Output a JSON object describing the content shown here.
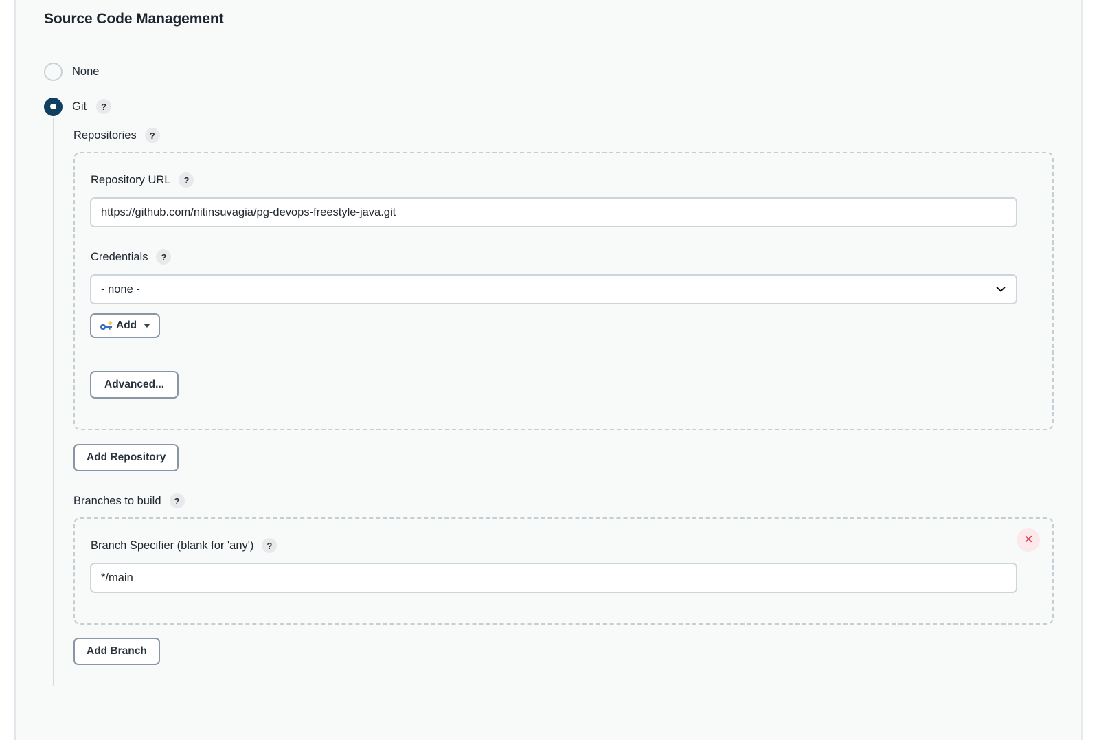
{
  "section": {
    "title": "Source Code Management"
  },
  "scm_options": [
    {
      "label": "None",
      "selected": false,
      "help": false
    },
    {
      "label": "Git",
      "selected": true,
      "help": true
    }
  ],
  "help_glyph": "?",
  "git": {
    "repositories": {
      "label": "Repositories",
      "repository_url": {
        "label": "Repository URL",
        "value": "https://github.com/nitinsuvagia/pg-devops-freestyle-java.git",
        "placeholder": ""
      },
      "credentials": {
        "label": "Credentials",
        "selected": "- none -",
        "options": [
          "- none -"
        ],
        "add_button": "Add",
        "add_icon": "key-icon"
      },
      "advanced_button": "Advanced...",
      "add_repository_button": "Add Repository"
    },
    "branches": {
      "label": "Branches to build",
      "branch_specifier": {
        "label": "Branch Specifier (blank for 'any')",
        "value": "*/main",
        "placeholder": ""
      },
      "delete_button_icon": "close-icon",
      "add_branch_button": "Add Branch"
    }
  },
  "colors": {
    "accent": "#10405f",
    "page_background": "#f8f9f9",
    "input_border": "#ccd5dc",
    "dashed_border": "#c6ced5",
    "danger": "#e0424f",
    "danger_background": "#fbe9ec",
    "key_icon_blue": "#3b6fc4",
    "key_icon_yellow": "#f5d04e"
  }
}
